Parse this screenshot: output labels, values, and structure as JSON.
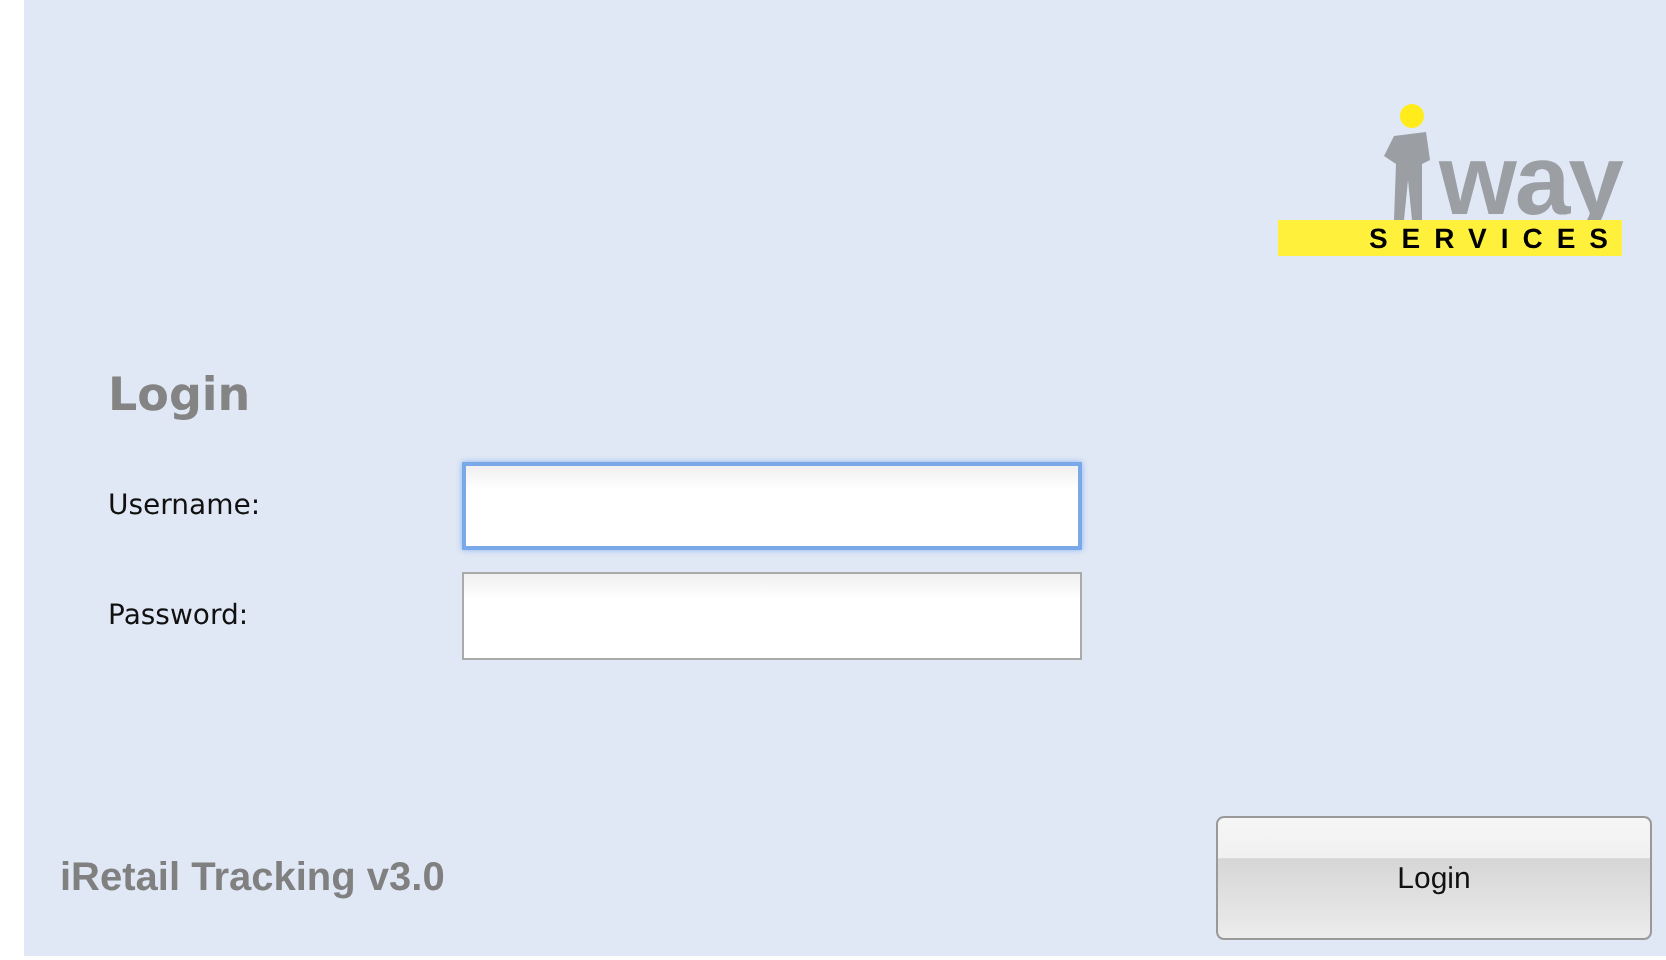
{
  "logo": {
    "word": "way",
    "tagline": "SERVICES"
  },
  "login_form": {
    "title": "Login",
    "fields": [
      {
        "label": "Username:",
        "focused": true
      },
      {
        "label": "Password:",
        "focused": false
      }
    ]
  },
  "footer": {
    "app_name": "iRetail Tracking v3.0",
    "button": "Login"
  }
}
